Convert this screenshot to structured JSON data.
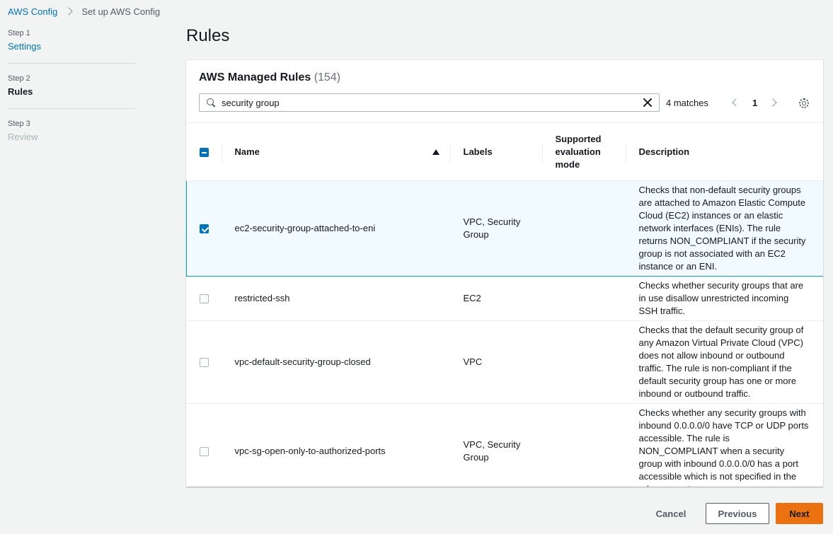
{
  "breadcrumb": {
    "root": "AWS Config",
    "current": "Set up AWS Config"
  },
  "steps": [
    {
      "num": "Step 1",
      "title": "Settings"
    },
    {
      "num": "Step 2",
      "title": "Rules"
    },
    {
      "num": "Step 3",
      "title": "Review"
    }
  ],
  "page_title": "Rules",
  "panel": {
    "title": "AWS Managed Rules",
    "count": "(154)",
    "search_value": "security group",
    "matches": "4 matches",
    "page": "1"
  },
  "table": {
    "columns": {
      "name": "Name",
      "labels": "Labels",
      "mode": "Supported evaluation mode",
      "description": "Description"
    },
    "rows": [
      {
        "name": "ec2-security-group-attached-to-eni",
        "labels": "VPC, Security Group",
        "mode": "",
        "description": "Checks that non-default security groups are attached to Amazon Elastic Compute Cloud (EC2) instances or an elastic network interfaces (ENIs). The rule returns NON_COMPLIANT if the security group is not associated with an EC2 instance or an ENI.",
        "selected": true
      },
      {
        "name": "restricted-ssh",
        "labels": "EC2",
        "mode": "",
        "description": "Checks whether security groups that are in use disallow unrestricted incoming SSH traffic.",
        "selected": false
      },
      {
        "name": "vpc-default-security-group-closed",
        "labels": "VPC",
        "mode": "",
        "description": "Checks that the default security group of any Amazon Virtual Private Cloud (VPC) does not allow inbound or outbound traffic. The rule is non-compliant if the default security group has one or more inbound or outbound traffic.",
        "selected": false
      },
      {
        "name": "vpc-sg-open-only-to-authorized-ports",
        "labels": "VPC, Security Group",
        "mode": "",
        "description": "Checks whether any security groups with inbound 0.0.0.0/0 have TCP or UDP ports accessible. The rule is NON_COMPLIANT when a security group with inbound 0.0.0.0/0 has a port accessible which is not specified in the rule parameters.",
        "selected": false
      }
    ]
  },
  "footer": {
    "cancel": "Cancel",
    "previous": "Previous",
    "next": "Next"
  },
  "colors": {
    "link": "#0073bb",
    "primary_button": "#ec7211",
    "selected_row_bg": "#f1faff",
    "selected_row_border": "#00a1c9"
  }
}
